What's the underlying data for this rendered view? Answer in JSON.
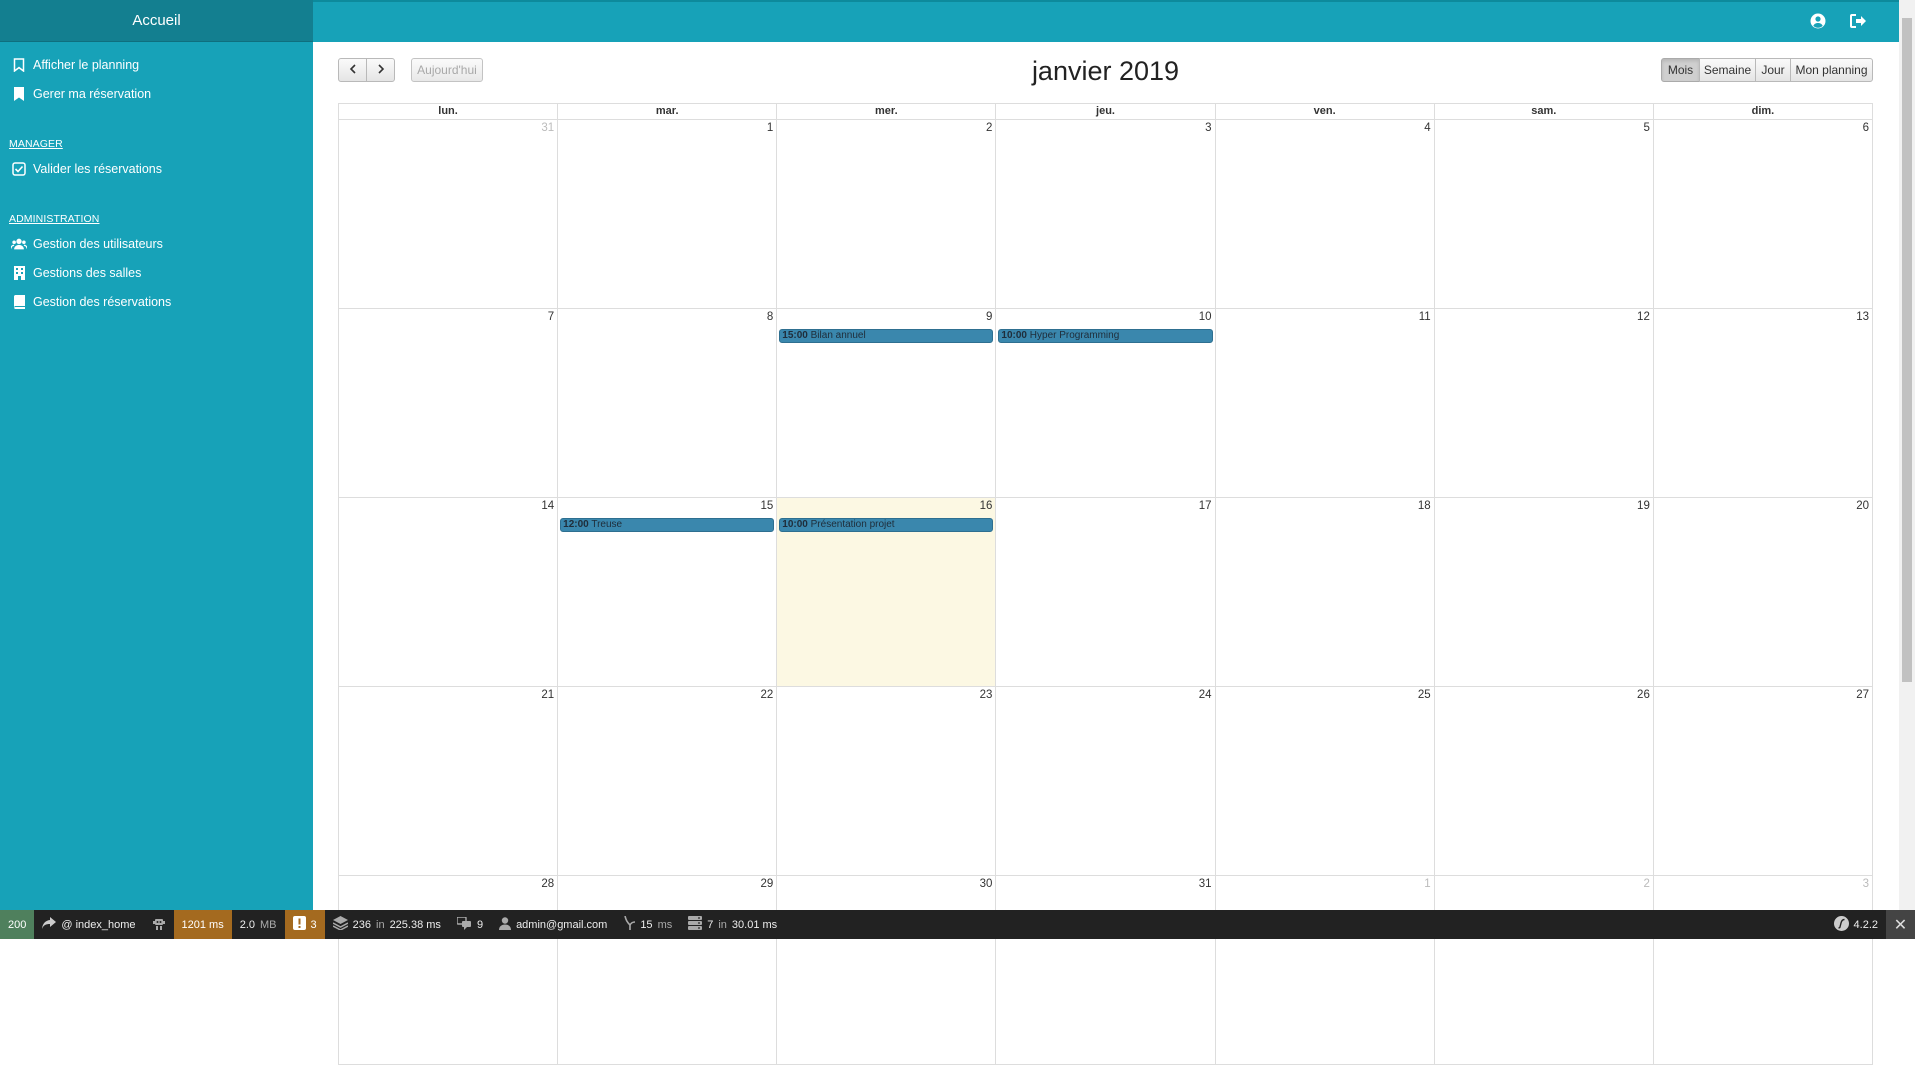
{
  "sidebar": {
    "header": "Accueil",
    "items": [
      {
        "label": "Afficher le planning"
      },
      {
        "label": "Gerer ma réservation"
      }
    ],
    "sections": [
      {
        "title": "MANAGER",
        "items": [
          {
            "label": "Valider les réservations"
          }
        ]
      },
      {
        "title": "ADMINISTRATION",
        "items": [
          {
            "label": "Gestion des utilisateurs"
          },
          {
            "label": "Gestions des salles"
          },
          {
            "label": "Gestion des réservations"
          }
        ]
      }
    ]
  },
  "topbar": {
    "icons": [
      "user-circle-icon",
      "sign-out-icon"
    ]
  },
  "calendar": {
    "title": "janvier 2019",
    "today_label": "Aujourd'hui",
    "views": [
      "Mois",
      "Semaine",
      "Jour",
      "Mon planning"
    ],
    "active_view": "Mois",
    "days_of_week": [
      "lun.",
      "mar.",
      "mer.",
      "jeu.",
      "ven.",
      "sam.",
      "dim."
    ],
    "weeks": [
      [
        "31",
        "1",
        "2",
        "3",
        "4",
        "5",
        "6"
      ],
      [
        "7",
        "8",
        "9",
        "10",
        "11",
        "12",
        "13"
      ],
      [
        "14",
        "15",
        "16",
        "17",
        "18",
        "19",
        "20"
      ],
      [
        "21",
        "22",
        "23",
        "24",
        "25",
        "26",
        "27"
      ],
      [
        "28",
        "29",
        "30",
        "31",
        "1",
        "2",
        "3"
      ]
    ],
    "events": [
      {
        "week": 1,
        "day": 2,
        "time": "15:00",
        "title": "Bilan annuel"
      },
      {
        "week": 1,
        "day": 3,
        "time": "10:00",
        "title": "Hyper Programming"
      },
      {
        "week": 2,
        "day": 1,
        "time": "12:00",
        "title": "Treuse"
      },
      {
        "week": 2,
        "day": 2,
        "time": "10:00",
        "title": "Présentation projet"
      }
    ],
    "today": {
      "week": 2,
      "day": 2
    }
  },
  "debugbar": {
    "status": "200",
    "route": "@ index_home",
    "time": "1201 ms",
    "memory": "2.0",
    "memory_unit": "MB",
    "warnings": "3",
    "cache": "236",
    "cache_in": "in",
    "cache_time": "225.38 ms",
    "forms": "9",
    "user": "admin@gmail.com",
    "twig": "15",
    "twig_unit": "ms",
    "db": "7",
    "db_in": "in",
    "db_time": "30.01 ms",
    "version": "4.2.2"
  }
}
